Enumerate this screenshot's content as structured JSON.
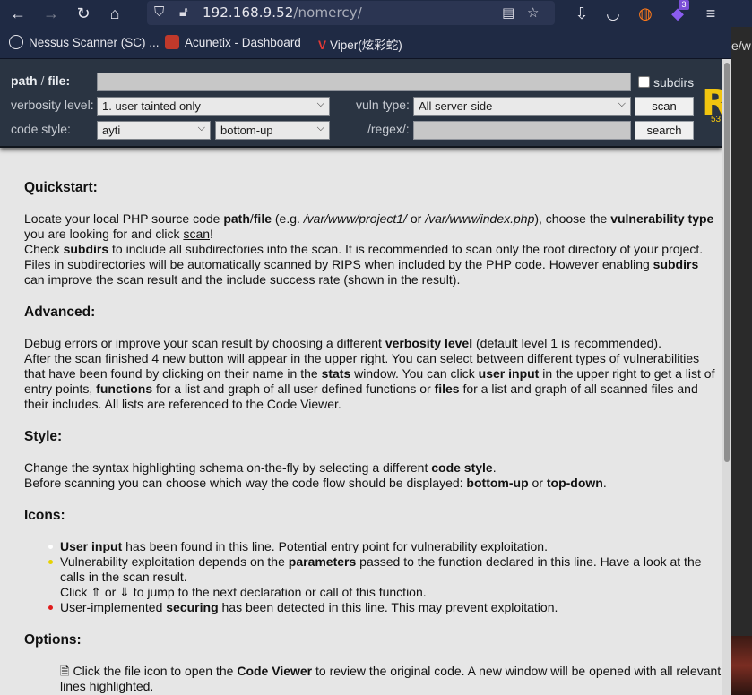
{
  "browser": {
    "url_host": "192.168.9.52",
    "url_path": "/nomercy/",
    "extension_badge": "3",
    "bookmarks": [
      {
        "label": "Nessus Scanner (SC) ...",
        "icon": "globe-icon"
      },
      {
        "label": "Acunetix - Dashboard",
        "icon": "acunetix-icon"
      },
      {
        "label": "Viper(炫彩蛇)",
        "icon": "viper-icon"
      }
    ],
    "side_text": "e/w"
  },
  "scan": {
    "path_label_a": "path",
    "path_label_sep": " / ",
    "path_label_b": "file:",
    "path_value": "",
    "subdirs_label": "subdirs",
    "verbosity_label": "verbosity level:",
    "verbosity_value": "1. user tainted only",
    "vuln_type_label": "vuln type:",
    "vuln_type_value": "All server-side",
    "scan_button": "scan",
    "code_style_label": "code style:",
    "code_style_value": "ayti",
    "flow_value": "bottom-up",
    "regex_label": "/regex/:",
    "regex_value": "",
    "search_button": "search",
    "logo_letter": "R",
    "logo_sub": "53"
  },
  "content": {
    "quickstart": {
      "title": "Quickstart:",
      "t1": "Locate your local PHP source code ",
      "b1": "path",
      "t2": "/",
      "b2": "file",
      "t3": " (e.g. ",
      "i1": "/var/www/project1/",
      "t4": " or ",
      "i2": "/var/www/index.php",
      "t5": "), choose the ",
      "b3": "vulnerability type",
      "t6": " you are looking for and click ",
      "u1": "scan",
      "t7": "!",
      "t8": "Check ",
      "b4": "subdirs",
      "t9": " to include all subdirectories into the scan. It is recommended to scan only the root directory of your project. Files in subdirectories will be automatically scanned by RIPS when included by the PHP code. However enabling ",
      "b5": "subdirs",
      "t10": " can improve the scan result and the include success rate (shown in the result)."
    },
    "advanced": {
      "title": "Advanced:",
      "t1": "Debug errors or improve your scan result by choosing a different ",
      "b1": "verbosity level",
      "t2": " (default level 1 is recommended).",
      "t3": "After the scan finished 4 new button will appear in the upper right. You can select between different types of vulnerabilities that have been found by clicking on their name in the ",
      "b2": "stats",
      "t4": " window. You can click ",
      "b3": "user input",
      "t5": " in the upper right to get a list of entry points, ",
      "b4": "functions",
      "t6": " for a list and graph of all user defined functions or ",
      "b5": "files",
      "t7": " for a list and graph of all scanned files and their includes. All lists are referenced to the Code Viewer."
    },
    "style": {
      "title": "Style:",
      "t1": "Change the syntax highlighting schema on-the-fly by selecting a different ",
      "b1": "code style",
      "t2": ".",
      "t3": "Before scanning you can choose which way the code flow should be displayed: ",
      "b2": "bottom-up",
      "t4": " or ",
      "b3": "top-down",
      "t5": "."
    },
    "icons": {
      "title": "Icons:",
      "i1_b": "User input",
      "i1_t": " has been found in this line. Potential entry point for vulnerability exploitation.",
      "i1_color": "#ffffff",
      "i2_t1": "Vulnerability exploitation depends on the ",
      "i2_b": "parameters",
      "i2_t2": " passed to the function declared in this line. Have a look at the calls in the scan result.",
      "i2_t3": "Click ⇑ or ⇓ to jump to the next declaration or call of this function.",
      "i2_color": "#e6d200",
      "i3_t1": "User-implemented ",
      "i3_b": "securing",
      "i3_t2": " has been detected in this line. This may prevent exploitation.",
      "i3_color": "#e01b1b"
    },
    "options": {
      "title": "Options:",
      "o1_t1": "Click the file icon to open the ",
      "o1_b": "Code Viewer",
      "o1_t2": " to review the original code. A new window will be opened with all relevant lines highlighted."
    }
  }
}
